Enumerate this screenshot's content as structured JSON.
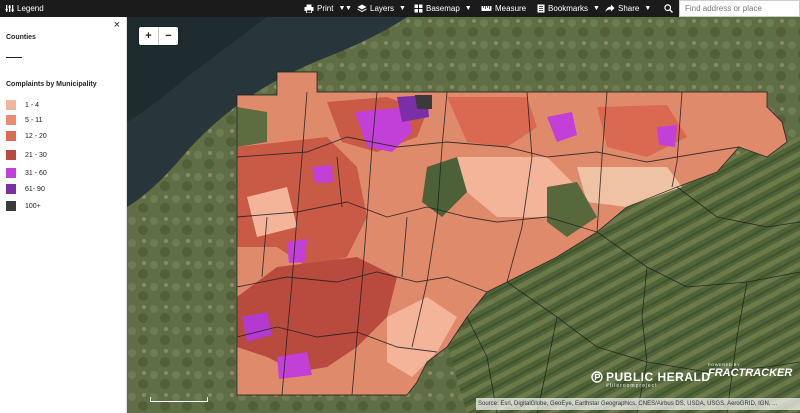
{
  "toolbar": {
    "legend_label": "Legend",
    "print_label": "Print",
    "layers_label": "Layers",
    "basemap_label": "Basemap",
    "measure_label": "Measure",
    "bookmarks_label": "Bookmarks",
    "share_label": "Share",
    "search_placeholder": "Find address or place"
  },
  "legend": {
    "close_glyph": "×",
    "counties_title": "Counties",
    "complaints_title": "Complaints by Municipality",
    "classes": [
      {
        "label": "1 - 4",
        "color": "#f3b49a"
      },
      {
        "label": "5 - 11",
        "color": "#ec8a6f"
      },
      {
        "label": "12 - 20",
        "color": "#d96a51"
      },
      {
        "label": "21 - 30",
        "color": "#b84a3e"
      },
      {
        "label": "31 - 60",
        "color": "#c23fd8"
      },
      {
        "label": "61- 90",
        "color": "#7a2fa6"
      },
      {
        "label": "100+",
        "color": "#3a3a3a"
      }
    ]
  },
  "map_controls": {
    "zoom_in": "+",
    "zoom_out": "−"
  },
  "attribution": "Source: Esri, DigitalGlobe, GeoEye, Earthstar Geographics, CNES/Airbus DS, USDA, USGS, AeroGRID, IGN, ...",
  "logos": {
    "public_herald": "PUBLIC HERALD",
    "public_herald_sub": "#fileroomproject",
    "fractracker_top": "POWERED BY",
    "fractracker": "FRACTRACKER"
  }
}
